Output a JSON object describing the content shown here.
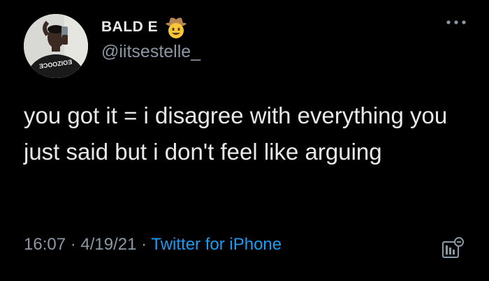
{
  "author": {
    "display_name": "BALD E",
    "emoji": "cowboy-hat-face-emoji",
    "handle": "@iitsestelle_",
    "avatar_shirt_text": "ƎƆOOZIOƎ"
  },
  "tweet": {
    "text": "you got it = i disagree with everything you just said but i don't feel like arguing"
  },
  "meta": {
    "time": "16:07",
    "separator": " · ",
    "date": "4/19/21",
    "source": "Twitter for iPhone"
  },
  "icons": {
    "more": "more-options-icon",
    "analytics": "analytics-icon"
  },
  "colors": {
    "background": "#000000",
    "text": "#e7e9ea",
    "secondary": "#8b98a5",
    "link": "#1d9bf0"
  }
}
